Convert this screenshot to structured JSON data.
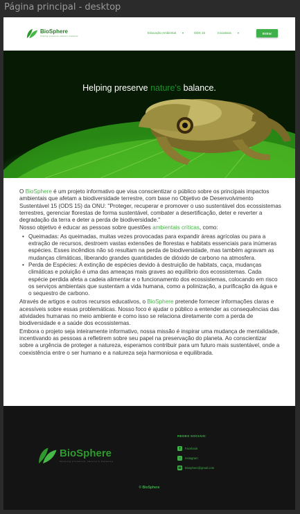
{
  "frame_title": "Página principal - desktop",
  "header": {
    "logo_name": "BioSphere",
    "logo_tagline": "helping preserve nature's balance",
    "nav": [
      {
        "label": "Educação Ambiental"
      },
      {
        "label": "ODS 15"
      },
      {
        "label": "Iniciativas"
      }
    ],
    "enter_label": "Entrar"
  },
  "hero": {
    "title_before": "Helping preserve ",
    "title_accent": "nature's",
    "title_after": " balance."
  },
  "content": {
    "p1_prefix": "O ",
    "p1_brand": "BioSphere",
    "p1_text": " é um projeto informativo que visa conscientizar o público sobre os principais impactos ambientais que afetam a biodiversidade terrestre, com base no Objetivo de Desenvolvimento Sustentável 15 (ODS 15) da ONU: \"Proteger, recuperar e promover o uso sustentável dos ecossistemas terrestres, gerenciar florestas de forma sustentável, combater a desertificação, deter e reverter a degradação da terra e deter a perda de biodiversidade.\"",
    "p2_text": "Nosso objetivo é educar as pessoas sobre questões ",
    "p2_link": "ambientais críticas",
    "p2_end": ", como:",
    "bullets": [
      "Queimadas: As queimadas, muitas vezes provocadas para expandir áreas agrícolas ou para a extração de recursos, destroem vastas extensões de florestas e habitats essenciais para inúmeras espécies. Esses incêndios não só resultam na perda de biodiversidade, mas também agravam as mudanças climáticas, liberando grandes quantidades de dióxido de carbono na atmosfera.",
      "Perda de Espécies: A extinção de espécies devido à destruição de habitats, caça, mudanças climáticas e poluição é uma das ameaças mais graves ao equilíbrio dos ecossistemas. Cada espécie perdida afeta a cadeia alimentar e o funcionamento dos ecossistemas, colocando em risco os serviços ambientais que sustentam a vida humana, como a polinização, a purificação da água e o sequestro de carbono."
    ],
    "p3_prefix": "Através de artigos e outros recursos educativos, o ",
    "p3_brand": "BioSphere",
    "p3_text": " pretende fornecer informações claras e acessíveis sobre essas problemáticas. Nosso foco é ajudar o público a entender as consequências das atividades humanas no meio ambiente e como isso se relaciona diretamente com a perda de biodiversidade e a saúde dos ecossistemas.",
    "p4_text": "Embora o projeto seja inteiramente informativo, nossa missão é inspirar uma mudança de mentalidade, incentivando as pessoas a refletirem sobre seu papel na preservação do planeta. Ao conscientizar sobre a urgência de proteger a natureza, esperamos contribuir para um futuro mais sustentável, onde a coexistência entre o ser humano e a natureza seja harmoniosa e equilibrada."
  },
  "footer": {
    "logo_name": "BioSphere",
    "logo_tagline": "helping preserve nature's balance",
    "social_title": "REDES SOCIAIS:",
    "social": [
      {
        "label": "Facebook",
        "icon": "facebook-icon"
      },
      {
        "label": "Instagram",
        "icon": "instagram-icon"
      },
      {
        "label": "Biosphere@gmail.com",
        "icon": "mail-icon"
      }
    ],
    "copyright": "© BioSphere"
  },
  "colors": {
    "accent": "#3fb04a",
    "footer_bg": "#141414"
  }
}
